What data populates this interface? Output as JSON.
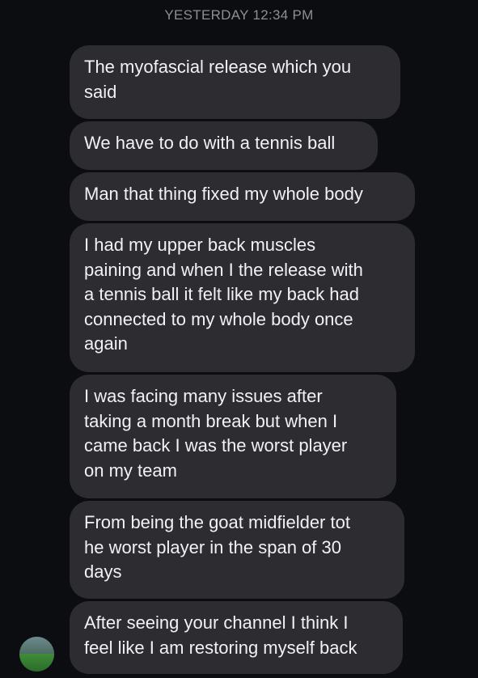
{
  "thread": {
    "timestamp": "YESTERDAY 12:34 PM"
  },
  "messages": [
    "The myofascial release which you\nsaid",
    "We have to do with a tennis ball",
    "Man that thing fixed my whole body",
    "I had my upper back muscles\npaining and when I the release with\na tennis ball it felt like my back had\nconnected to my whole body once\nagain",
    "I was facing many issues after\ntaking a month break but when I\ncame back I was the worst player\non my team",
    "From being the goat midfielder tot\nhe worst player in the span of 30\ndays",
    "After seeing your channel I think I\nfeel like I am restoring myself back"
  ],
  "sender": {
    "avatar_icon": "profile-photo-avatar"
  },
  "colors": {
    "background": "#0b0d11",
    "bubble": "#2c2c31",
    "text": "#f2f2f4",
    "timestamp": "#8e8e95"
  }
}
